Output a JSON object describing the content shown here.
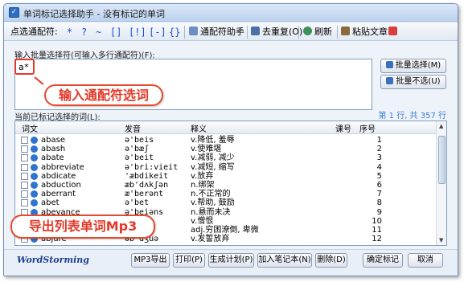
{
  "window": {
    "title": "单词标记选择助手 - 没有标记的单词"
  },
  "toolbar": {
    "wildcard_label": "点选通配符:",
    "wildcards": [
      "*",
      "?",
      "~",
      "[]",
      "[!]",
      "[-]",
      "{}"
    ],
    "wildcard_helper": "通配符助手",
    "dedupe": "去重复(O)",
    "refresh": "刷新",
    "paste": "粘贴文章"
  },
  "input": {
    "label": "输入批量选择符(可输入多行通配符)(F):",
    "value": "a*"
  },
  "side_buttons": {
    "select": "批量选择(M)",
    "deselect": "批量不选(U)"
  },
  "callouts": {
    "wildcard": "输入通配符选词",
    "export": "导出列表单词Mp3"
  },
  "list": {
    "label": "当前已标记选择的词(L):",
    "status": "第 1 行, 共 357 行",
    "headers": [
      "词文",
      "发音",
      "释义",
      "课号",
      "序号"
    ],
    "rows": [
      {
        "word": "abase",
        "phon": "ə'beis",
        "def": "v.降低, 羞辱",
        "lesson": "",
        "no": "1"
      },
      {
        "word": "abash",
        "phon": "ə'bæʃ",
        "def": "v.使难堪",
        "lesson": "",
        "no": "2"
      },
      {
        "word": "abate",
        "phon": "ə'beit",
        "def": "v.减弱, 减少",
        "lesson": "",
        "no": "3"
      },
      {
        "word": "abbreviate",
        "phon": "ə'bri:vieit",
        "def": "v.减短, 缩写",
        "lesson": "",
        "no": "4"
      },
      {
        "word": "abdicate",
        "phon": "'æbdikeit",
        "def": "v.放弃",
        "lesson": "",
        "no": "5"
      },
      {
        "word": "abduction",
        "phon": "æb'dʌkʃən",
        "def": "n.绑架",
        "lesson": "",
        "no": "6"
      },
      {
        "word": "aberrant",
        "phon": "æ'berənt",
        "def": "n.不正常的",
        "lesson": "",
        "no": "7"
      },
      {
        "word": "abet",
        "phon": "ə'bet",
        "def": "v.帮助, 鼓励",
        "lesson": "",
        "no": "8"
      },
      {
        "word": "abeyance",
        "phon": "ə'beiəns",
        "def": "n.悬而未决",
        "lesson": "",
        "no": "9"
      },
      {
        "word": "",
        "phon": "",
        "def": "v.憎恨",
        "lesson": "",
        "no": "10"
      },
      {
        "word": "",
        "phon": "",
        "def": "adj.穷困潦倒, 卑微",
        "lesson": "",
        "no": "11"
      },
      {
        "word": "abjure",
        "phon": "əb'dʒuə",
        "def": "v.发誓放弃",
        "lesson": "",
        "no": "12"
      }
    ]
  },
  "bottom": {
    "brand": "WordStorming",
    "buttons": [
      "MP3导出",
      "打印(P)",
      "生成计划(P)",
      "加入笔记本(N)",
      "删除(D)",
      "确定标记",
      "取消"
    ]
  },
  "colors": {
    "accent": "#e23a2a",
    "status": "#3b7fd1",
    "wildcard": "#1f4fcf"
  }
}
